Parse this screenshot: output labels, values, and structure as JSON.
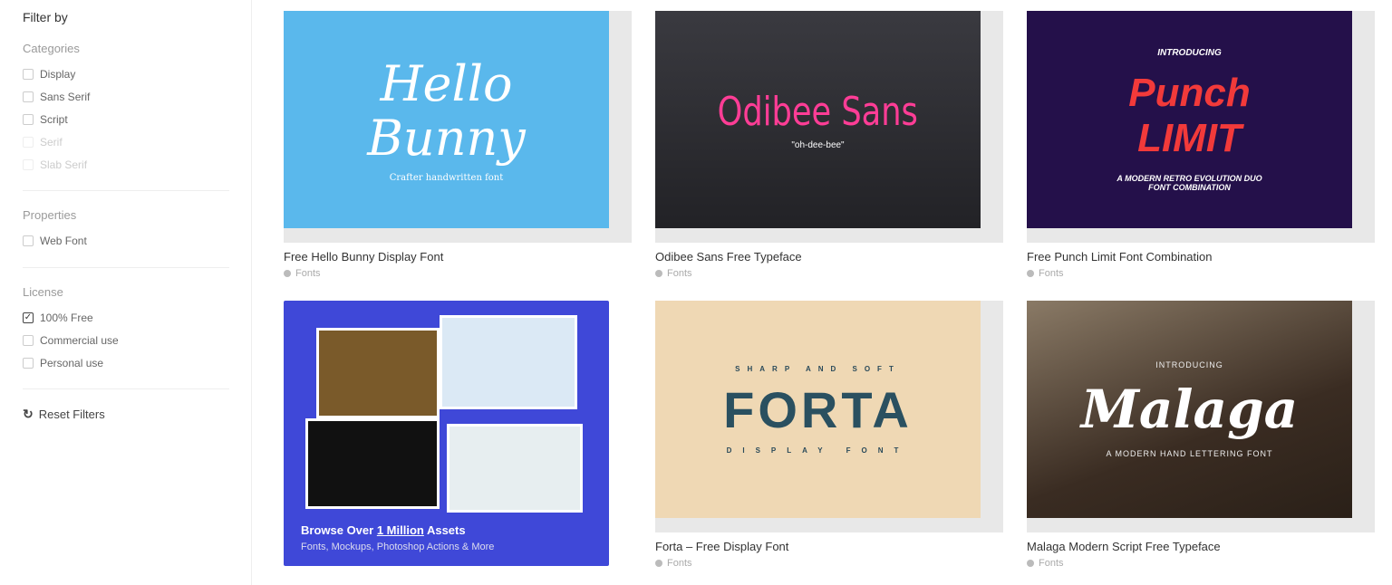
{
  "sidebar": {
    "title": "Filter by",
    "categories": {
      "heading": "Categories",
      "items": [
        {
          "label": "Display",
          "checked": false,
          "disabled": false
        },
        {
          "label": "Sans Serif",
          "checked": false,
          "disabled": false
        },
        {
          "label": "Script",
          "checked": false,
          "disabled": false
        },
        {
          "label": "Serif",
          "checked": false,
          "disabled": true
        },
        {
          "label": "Slab Serif",
          "checked": false,
          "disabled": true
        }
      ]
    },
    "properties": {
      "heading": "Properties",
      "items": [
        {
          "label": "Web Font",
          "checked": false
        }
      ]
    },
    "license": {
      "heading": "License",
      "items": [
        {
          "label": "100% Free",
          "checked": true
        },
        {
          "label": "Commercial use",
          "checked": false
        },
        {
          "label": "Personal use",
          "checked": false
        }
      ]
    },
    "reset": "Reset Filters"
  },
  "cards": [
    {
      "title": "Free Hello Bunny Display Font",
      "tag": "Fonts",
      "art": "Hello Bunny",
      "art_sub": "Crafter handwritten font",
      "bg": "#5ab8ec"
    },
    {
      "title": "Odibee Sans Free Typeface",
      "tag": "Fonts",
      "art": "Odibee Sans",
      "art_sub": "\"oh-dee-bee\"",
      "bg": "#2b2b30"
    },
    {
      "title": "Free Punch Limit Font Combination",
      "tag": "Fonts",
      "art_top": "INTRODUCING",
      "art": "Punch LIMIT",
      "art_sub": "A MODERN RETRO EVOLUTION DUO FONT COMBINATION",
      "bg": "#24104a"
    },
    {
      "title": "Forta – Free Display Font",
      "tag": "Fonts",
      "art_top": "SHARP AND SOFT",
      "art": "FORTA",
      "art_sub": "DISPLAY FONT",
      "bg": "#efd8b4"
    },
    {
      "title": "Malaga Modern Script Free Typeface",
      "tag": "Fonts",
      "art_top": "INTRODUCING",
      "art": "Malaga",
      "art_sub": "A MODERN HAND LETTERING FONT",
      "bg": "#4a3b30"
    }
  ],
  "promo": {
    "pre": "Browse Over ",
    "link": "1 Million",
    "post": " Assets",
    "sub": "Fonts, Mockups, Photoshop Actions & More",
    "bg": "#3f48d8"
  }
}
